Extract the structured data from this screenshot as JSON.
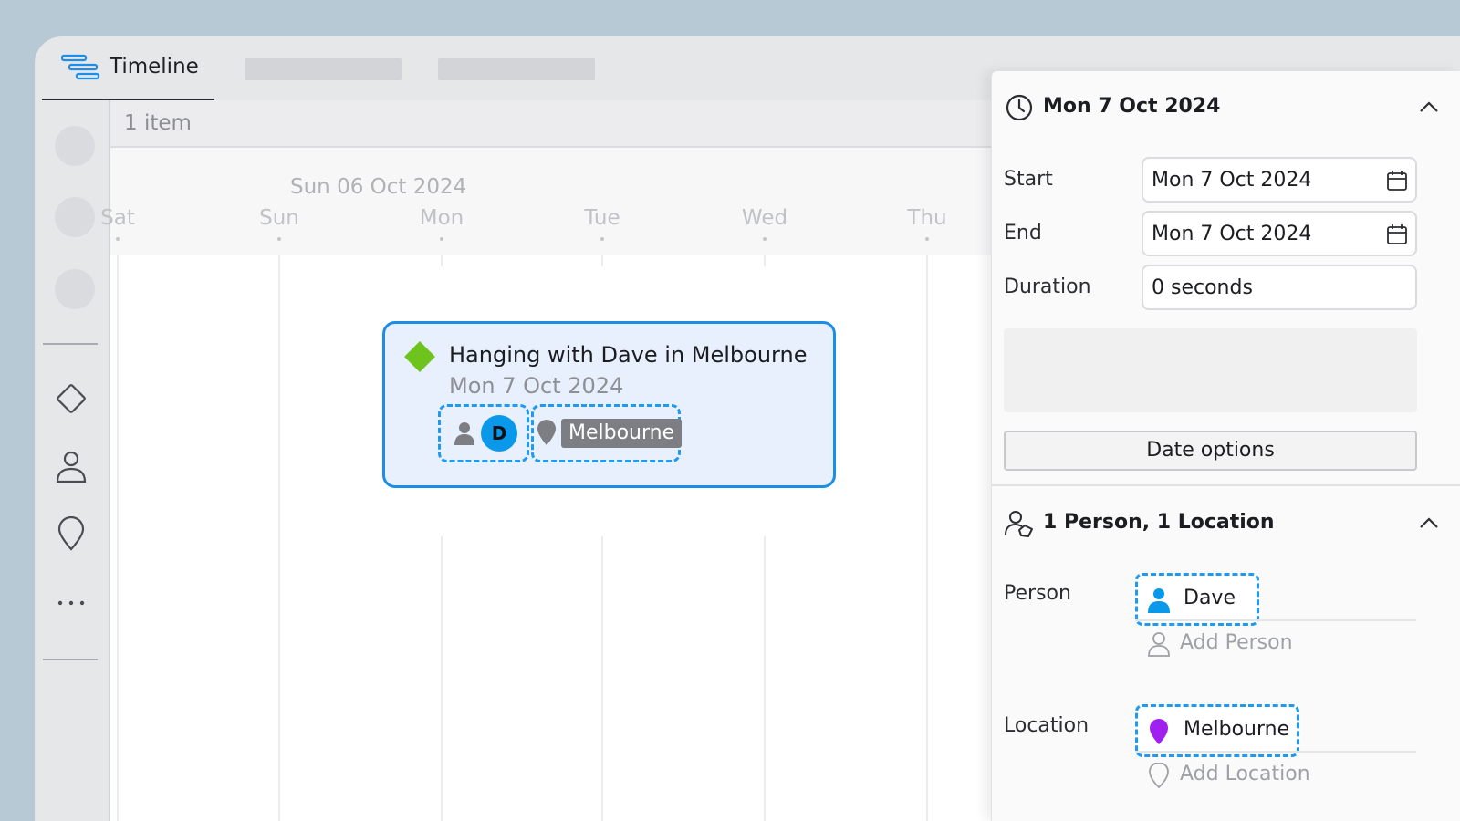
{
  "tabs": {
    "active_label": "Timeline"
  },
  "item_count": "1 item",
  "ruler": {
    "date_header": "Sun 06 Oct 2024",
    "days": [
      "Sat",
      "Sun",
      "Mon",
      "Tue",
      "Wed",
      "Thu"
    ]
  },
  "event": {
    "title": "Hanging with Dave in Melbourne",
    "date": "Mon 7 Oct 2024",
    "person_initial": "D",
    "location": "Melbourne"
  },
  "panel": {
    "date_section": {
      "title": "Mon 7 Oct 2024",
      "start_label": "Start",
      "start_value": "Mon 7 Oct 2024",
      "end_label": "End",
      "end_value": "Mon 7 Oct 2024",
      "duration_label": "Duration",
      "duration_value": "0 seconds",
      "date_options_label": "Date options"
    },
    "tags_section": {
      "title": "1 Person, 1 Location",
      "person_label": "Person",
      "person_value": "Dave",
      "add_person": "Add Person",
      "location_label": "Location",
      "location_value": "Melbourne",
      "add_location": "Add Location"
    }
  },
  "colors": {
    "accent": "#1e9af0",
    "event_diamond": "#6ec31c",
    "location_pin": "#a020f0",
    "person_icon": "#0a98ea"
  }
}
